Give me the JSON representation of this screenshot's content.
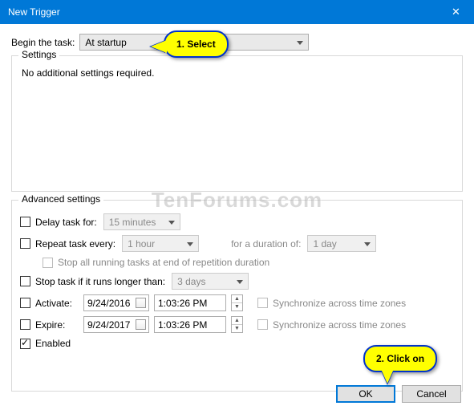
{
  "window": {
    "title": "New Trigger"
  },
  "begin_label": "Begin the task:",
  "begin_value": "At startup",
  "settings": {
    "legend": "Settings",
    "message": "No additional settings required."
  },
  "advanced": {
    "legend": "Advanced settings",
    "delay": {
      "label": "Delay task for:",
      "value": "15 minutes",
      "checked": false
    },
    "repeat": {
      "label": "Repeat task every:",
      "value": "1 hour",
      "duration_label": "for a duration of:",
      "duration_value": "1 day",
      "checked": false
    },
    "stop_repetition": {
      "label": "Stop all running tasks at end of repetition duration",
      "checked": false
    },
    "stop_longer": {
      "label": "Stop task if it runs longer than:",
      "value": "3 days",
      "checked": false
    },
    "activate": {
      "label": "Activate:",
      "date": "9/24/2016",
      "time": "1:03:26 PM",
      "sync": "Synchronize across time zones",
      "checked": false
    },
    "expire": {
      "label": "Expire:",
      "date": "9/24/2017",
      "time": "1:03:26 PM",
      "sync": "Synchronize across time zones",
      "checked": false
    },
    "enabled": {
      "label": "Enabled",
      "checked": true
    }
  },
  "buttons": {
    "ok": "OK",
    "cancel": "Cancel"
  },
  "callouts": {
    "c1": "1. Select",
    "c2": "2. Click on"
  },
  "watermark": "TenForums.com"
}
